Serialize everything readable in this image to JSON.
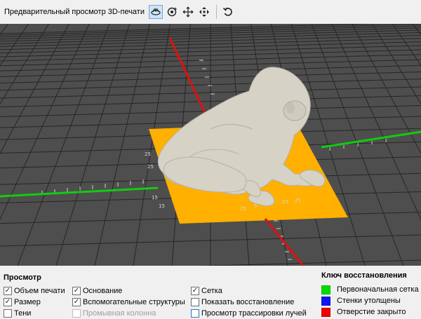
{
  "toolbar": {
    "title": "Предварительный просмотр 3D-печати",
    "icons": [
      "view-icon",
      "rotate-icon",
      "pan-icon",
      "move-icon",
      "reset-icon"
    ]
  },
  "viewport": {
    "colors": {
      "background": "#4e4e4e",
      "grid": "#262626",
      "x_axis": "#11cc11",
      "y_axis": "#dd1111",
      "base_plate": "#ffb000",
      "model": "#d6d3c6"
    },
    "tick_labels": [
      "25",
      "25",
      "15",
      "15",
      "25",
      "5",
      "5",
      "15",
      "25"
    ]
  },
  "panel": {
    "title": "Просмотр",
    "options": [
      {
        "label": "Объем печати",
        "checked": true,
        "enabled": true
      },
      {
        "label": "Размер",
        "checked": true,
        "enabled": true
      },
      {
        "label": "Тени",
        "checked": false,
        "enabled": true
      },
      {
        "label": "Основание",
        "checked": true,
        "enabled": true
      },
      {
        "label": "Вспомогательные структуры",
        "checked": true,
        "enabled": true
      },
      {
        "label": "Промывная колонна",
        "checked": false,
        "enabled": false
      },
      {
        "label": "Сетка",
        "checked": true,
        "enabled": true
      },
      {
        "label": "Показать восстановление",
        "checked": false,
        "enabled": true
      },
      {
        "label": "Просмотр трассировки лучей",
        "checked": false,
        "enabled": true
      }
    ]
  },
  "key": {
    "title": "Ключ восстановления",
    "items": [
      {
        "label": "Первоначальная сетка",
        "color": "#00dd00"
      },
      {
        "label": "Стенки утолщены",
        "color": "#0a18ee"
      },
      {
        "label": "Отверстие закрыто",
        "color": "#ee0000"
      }
    ]
  }
}
